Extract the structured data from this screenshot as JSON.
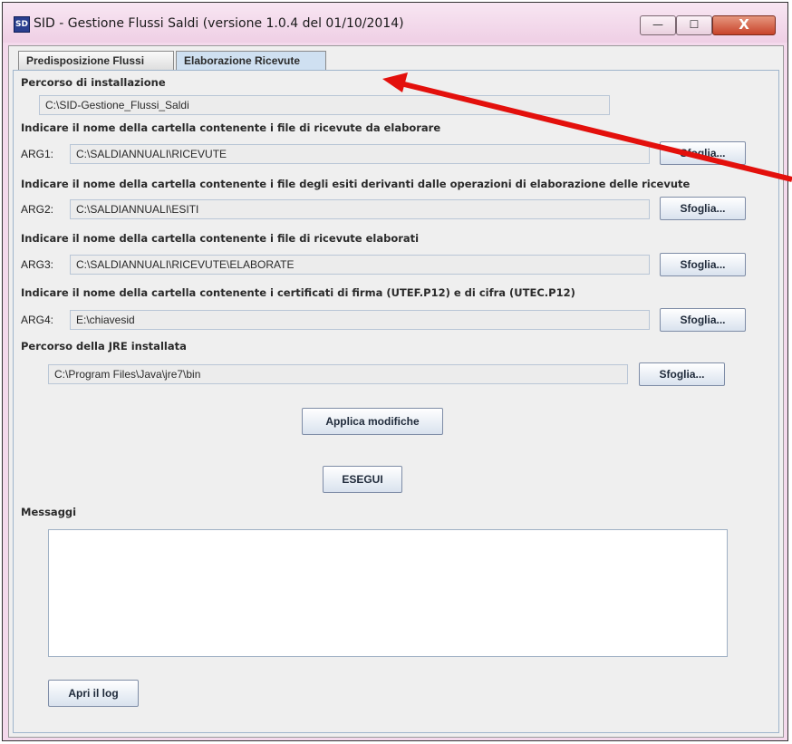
{
  "window": {
    "title": "SID - Gestione Flussi Saldi (versione 1.0.4 del 01/10/2014)",
    "icon_label": "SD",
    "controls": {
      "minimize": "—",
      "maximize": "☐",
      "close": "X"
    }
  },
  "tabs": [
    {
      "label": "Predisposizione Flussi",
      "active": false
    },
    {
      "label": "Elaborazione Ricevute",
      "active": true
    }
  ],
  "form": {
    "install_label": "Percorso di installazione",
    "install_path": "C:\\SID-Gestione_Flussi_Saldi",
    "arg1_desc": "Indicare il nome della cartella contenente i file di ricevute da elaborare",
    "arg1_label": "ARG1:",
    "arg1_value": "C:\\SALDIANNUALI\\RICEVUTE",
    "arg2_desc": "Indicare il nome della cartella contenente i file degli esiti derivanti dalle operazioni di elaborazione delle ricevute",
    "arg2_label": "ARG2:",
    "arg2_value": "C:\\SALDIANNUALI\\ESITI",
    "arg3_desc": "Indicare il nome della cartella contenente i file di ricevute elaborati",
    "arg3_label": "ARG3:",
    "arg3_value": "C:\\SALDIANNUALI\\RICEVUTE\\ELABORATE",
    "arg4_desc": "Indicare il nome della cartella contenente i certificati di firma (UTEF.P12) e di cifra (UTEC.P12)",
    "arg4_label": "ARG4:",
    "arg4_value": "E:\\chiavesid",
    "jre_label": "Percorso della JRE installata",
    "jre_value": "C:\\Program Files\\Java\\jre7\\bin",
    "browse_label": "Sfoglia...",
    "apply_label": "Applica modifiche",
    "run_label": "ESEGUI",
    "messages_label": "Messaggi",
    "open_log_label": "Apri il log"
  },
  "annotation": {
    "arrow_color": "#e3100c"
  }
}
